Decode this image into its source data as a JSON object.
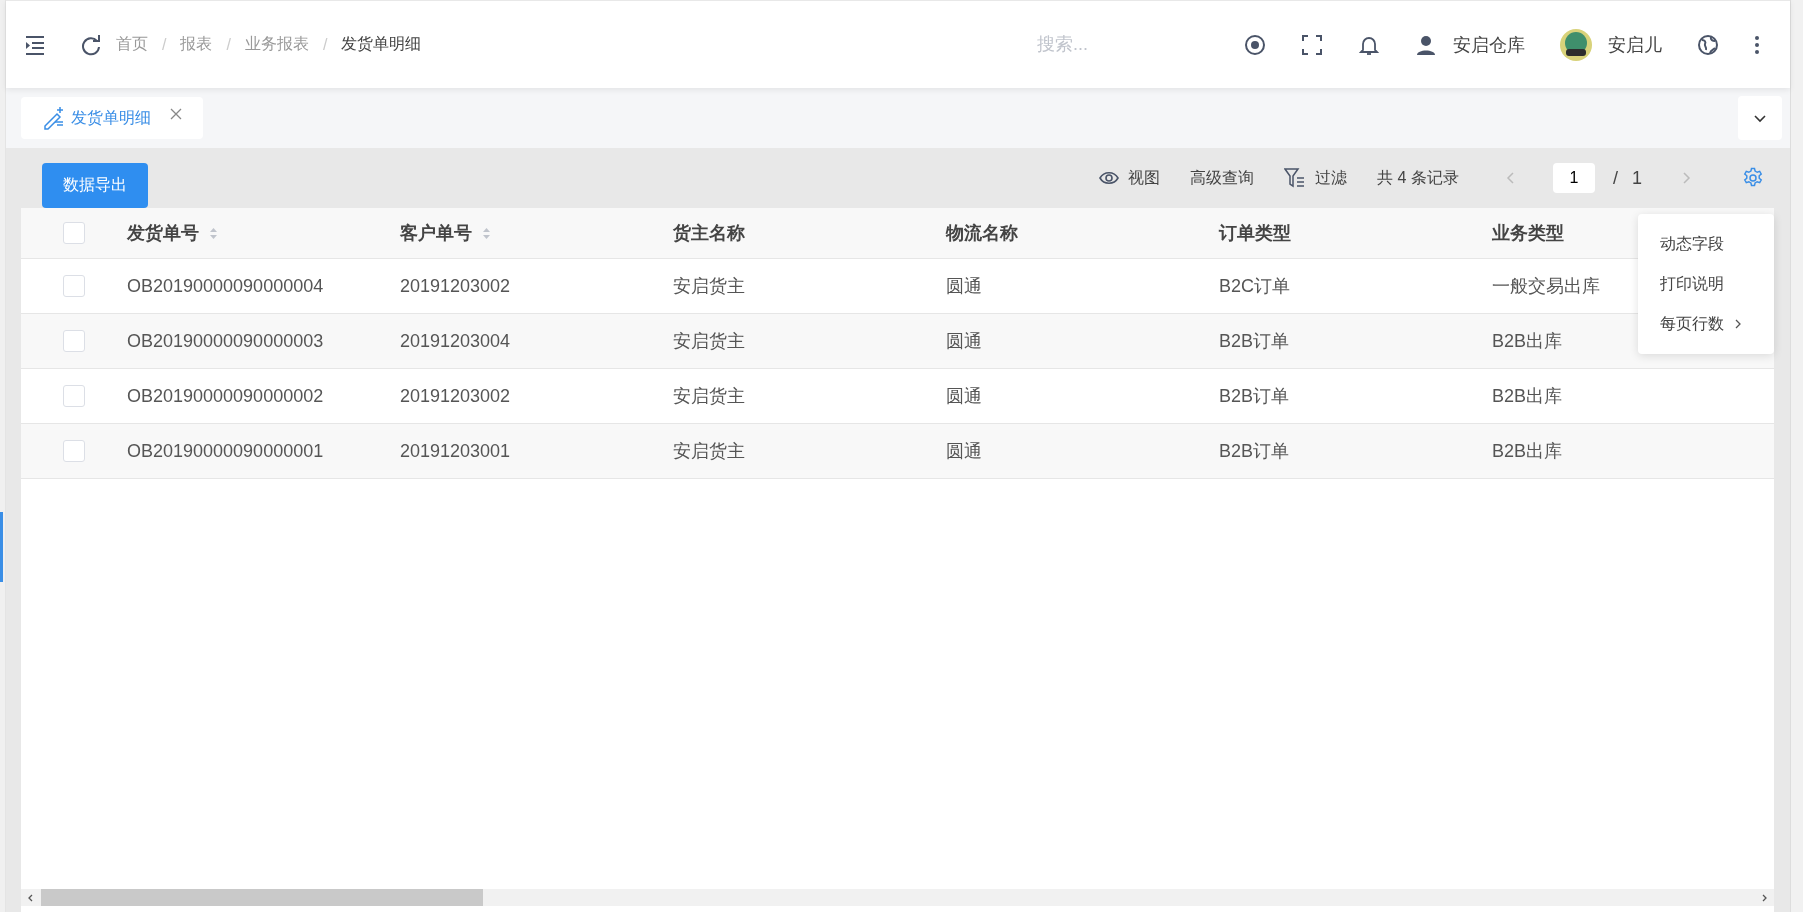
{
  "header": {
    "breadcrumb": [
      {
        "label": "首页",
        "current": false
      },
      {
        "label": "报表",
        "current": false
      },
      {
        "label": "业务报表",
        "current": false
      },
      {
        "label": "发货单明细",
        "current": true
      }
    ],
    "separator": "/",
    "search": {
      "placeholder": "搜索..."
    },
    "warehouse": "安启仓库",
    "user": "安启儿"
  },
  "tabs": [
    {
      "label": "发货单明细",
      "selected": true
    }
  ],
  "toolbar": {
    "export_button": "数据导出",
    "view": "视图",
    "advanced_query": "高级查询",
    "filter": "过滤",
    "record_count": "共 4 条记录",
    "page": "1",
    "page_separator": "/",
    "page_total": "1"
  },
  "table": {
    "select_all": {
      "checked": false
    },
    "columns": [
      {
        "label": "发货单号",
        "sortable": true
      },
      {
        "label": "客户单号",
        "sortable": true
      },
      {
        "label": "货主名称",
        "sortable": false
      },
      {
        "label": "物流名称",
        "sortable": false
      },
      {
        "label": "订单类型",
        "sortable": false
      },
      {
        "label": "业务类型",
        "sortable": false
      }
    ],
    "rows": [
      {
        "checked": false,
        "cells": [
          "OB20190000090000004",
          "20191203002",
          "安启货主",
          "圆通",
          "B2C订单",
          "一般交易出库"
        ]
      },
      {
        "checked": false,
        "cells": [
          "OB20190000090000003",
          "20191203004",
          "安启货主",
          "圆通",
          "B2B订单",
          "B2B出库"
        ]
      },
      {
        "checked": false,
        "cells": [
          "OB20190000090000002",
          "20191203002",
          "安启货主",
          "圆通",
          "B2B订单",
          "B2B出库"
        ]
      },
      {
        "checked": false,
        "cells": [
          "OB20190000090000001",
          "20191203001",
          "安启货主",
          "圆通",
          "B2B订单",
          "B2B出库"
        ]
      }
    ]
  },
  "settings_menu": {
    "items": [
      {
        "label": "动态字段",
        "has_submenu": false
      },
      {
        "label": "打印说明",
        "has_submenu": false
      },
      {
        "label": "每页行数",
        "has_submenu": true
      }
    ]
  }
}
